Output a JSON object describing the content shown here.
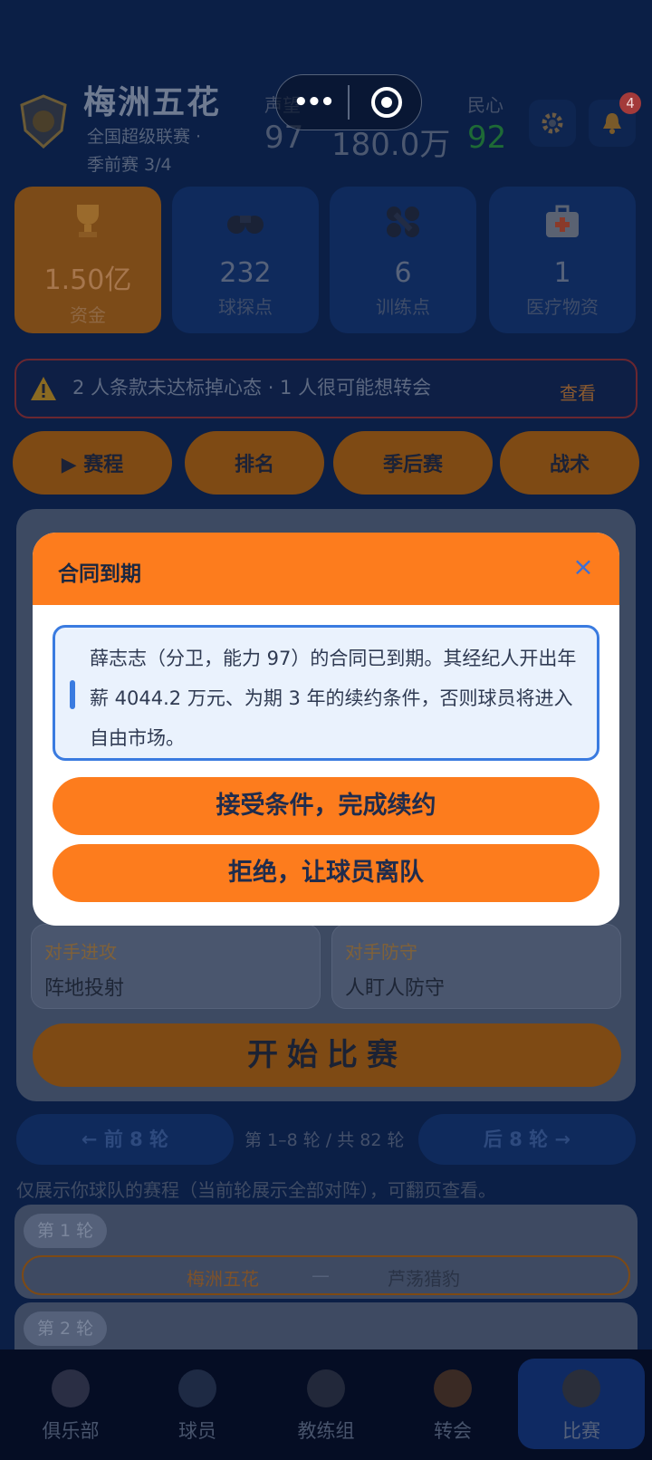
{
  "header": {
    "club_name": "梅洲五花",
    "league": "全国超级联赛 ·",
    "season": "季前赛 3/4",
    "stats": [
      {
        "label": "声望",
        "value": "97"
      },
      {
        "label": "",
        "value": "180.0万"
      },
      {
        "label": "民心",
        "value": "92"
      }
    ],
    "notification_count": "4"
  },
  "resources": [
    {
      "value": "1.50亿",
      "label": "资金"
    },
    {
      "value": "232",
      "label": "球探点"
    },
    {
      "value": "6",
      "label": "训练点"
    },
    {
      "value": "1",
      "label": "医疗物资"
    }
  ],
  "alert": {
    "text": "2 人条款未达标掉心态 · 1 人很可能想转会",
    "link": "查看"
  },
  "nav_buttons": [
    "▶ 赛程",
    "排名",
    "季后赛",
    "战术"
  ],
  "tactics": [
    {
      "label": "对手进攻",
      "value": "阵地投射"
    },
    {
      "label": "对手防守",
      "value": "人盯人防守"
    }
  ],
  "start_button": "开始比赛",
  "pager": {
    "prev": "← 前 8 轮",
    "info": "第 1–8 轮 / 共 82 轮",
    "next": "后 8 轮 →"
  },
  "hint": "仅展示你球队的赛程（当前轮展示全部对阵），可翻页查看。",
  "rounds": [
    {
      "tag": "第 1 轮",
      "home": "梅洲五花",
      "dash": "—",
      "away": "芦荡猎豹"
    },
    {
      "tag": "第 2 轮"
    }
  ],
  "tabs": [
    "俱乐部",
    "球员",
    "教练组",
    "转会",
    "比赛"
  ],
  "modal": {
    "title": "合同到期",
    "close": "×",
    "message": "薛志志（分卫，能力 97）的合同已到期。其经纪人开出年薪 4044.2 万元、为期 3 年的续约条件，否则球员将进入自由市场。",
    "accept": "接受条件，完成续约",
    "reject": "拒绝，让球员离队"
  },
  "colors": {
    "accent": "#fd7c1d",
    "info_border": "#3a7be0",
    "background": "#0b1f46"
  }
}
